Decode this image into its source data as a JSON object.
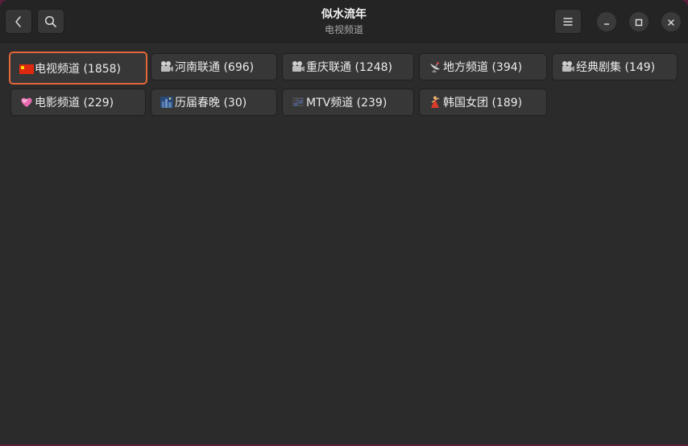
{
  "window": {
    "title": "似水流年",
    "subtitle": "电视频道"
  },
  "header": {
    "back_icon": "chevron-left-icon",
    "search_icon": "search-icon",
    "menu_icon": "hamburger-menu-icon",
    "minimize_icon": "minimize-icon",
    "maximize_icon": "maximize-icon",
    "close_icon": "close-icon"
  },
  "channels": [
    {
      "label": "电视频道 (1858)",
      "icon": "china-flag-icon",
      "selected": true
    },
    {
      "label": "河南联通 (696)",
      "icon": "movie-camera-icon",
      "selected": false
    },
    {
      "label": "重庆联通 (1248)",
      "icon": "movie-camera-icon",
      "selected": false
    },
    {
      "label": "地方频道 (394)",
      "icon": "satellite-antenna-icon",
      "selected": false
    },
    {
      "label": "经典剧集 (149)",
      "icon": "movie-camera-icon",
      "selected": false
    },
    {
      "label": "电影频道 (229)",
      "icon": "heart-icon",
      "selected": false
    },
    {
      "label": "历届春晚 (30)",
      "icon": "night-city-icon",
      "selected": false
    },
    {
      "label": "MTV频道 (239)",
      "icon": "music-notes-icon",
      "selected": false
    },
    {
      "label": "韩国女团 (189)",
      "icon": "dancer-icon",
      "selected": false
    }
  ],
  "colors": {
    "accent_selected": "#e2673a",
    "window_bg": "#2b2b2b",
    "header_bg": "#242424",
    "button_bg": "#373737",
    "desktop_bg": "#5a1f3a"
  }
}
